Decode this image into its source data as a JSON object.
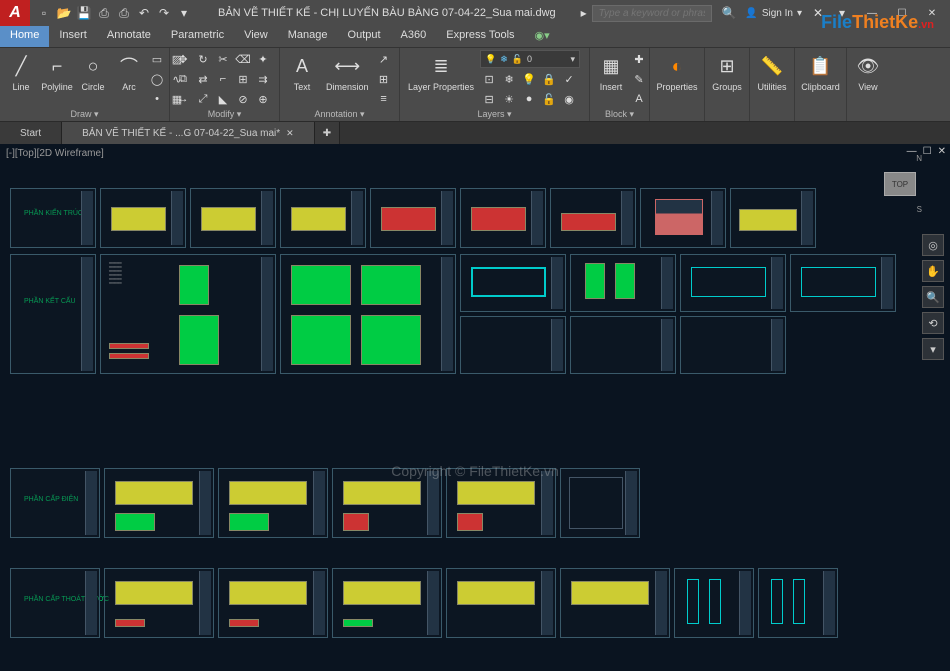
{
  "title": "BẢN VẼ THIẾT KẾ  - CHỊ LUYẾN BÀU BÀNG 07-04-22_Sua mai.dwg",
  "search_placeholder": "Type a keyword or phrase",
  "signin": "Sign In",
  "ribbon_tabs": [
    "Home",
    "Insert",
    "Annotate",
    "Parametric",
    "View",
    "Manage",
    "Output",
    "A360",
    "Express Tools"
  ],
  "panels": {
    "draw": {
      "title": "Draw ▾",
      "btns": [
        "Line",
        "Polyline",
        "Circle",
        "Arc"
      ]
    },
    "modify": {
      "title": "Modify ▾"
    },
    "annotation": {
      "title": "Annotation ▾",
      "btns": [
        "Text",
        "Dimension"
      ]
    },
    "layers": {
      "title": "Layers ▾",
      "btn": "Layer Properties",
      "current": "0"
    },
    "block": {
      "title": "Block ▾",
      "btn": "Insert"
    },
    "properties": {
      "title": "Properties"
    },
    "groups": {
      "title": "Groups"
    },
    "utilities": {
      "title": "Utilities"
    },
    "clipboard": {
      "title": "Clipboard"
    },
    "view": {
      "title": "View"
    }
  },
  "file_tabs": {
    "start": "Start",
    "doc": "BẢN VẼ THIẾT KẾ - ...G 07-04-22_Sua mai*"
  },
  "viewport_label": "[-][Top][2D Wireframe]",
  "viewcube": {
    "face": "TOP",
    "n": "N",
    "s": "S"
  },
  "sections": {
    "arch": "PHẦN KIẾN TRÚC",
    "struct": "PHẦN KẾT CẤU",
    "elec": "PHẦN CẤP ĐIỆN",
    "plumb": "PHẦN CẤP THOÁT NƯỚC"
  },
  "watermark": "Copyright © FileThietKe.vn",
  "logo": {
    "file": "File",
    "thietke": "ThietKe",
    "vn": ".vn"
  }
}
